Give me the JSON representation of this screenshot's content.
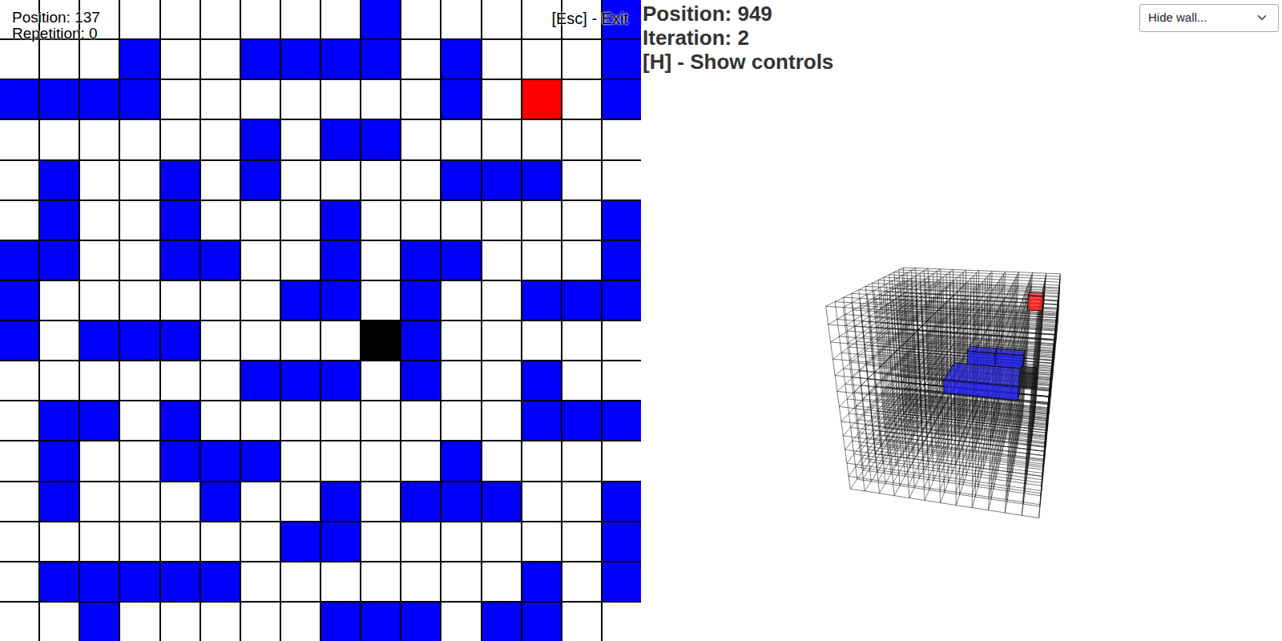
{
  "grid_hud": {
    "position": "Position: 137",
    "repetition": "Repetition: 0",
    "exit": "[Esc] - Exit"
  },
  "grid": {
    "rows": [
      [
        "open",
        "open",
        "open",
        "open",
        "open",
        "open",
        "open",
        "open",
        "open",
        "wall",
        "open",
        "open",
        "open",
        "open",
        "open",
        "wall"
      ],
      [
        "open",
        "open",
        "open",
        "wall",
        "open",
        "open",
        "wall",
        "wall",
        "wall",
        "wall",
        "open",
        "wall",
        "open",
        "open",
        "open",
        "wall"
      ],
      [
        "wall",
        "wall",
        "wall",
        "wall",
        "open",
        "open",
        "open",
        "open",
        "open",
        "open",
        "open",
        "wall",
        "open",
        "goal",
        "open",
        "wall"
      ],
      [
        "open",
        "open",
        "open",
        "open",
        "open",
        "open",
        "wall",
        "open",
        "wall",
        "wall",
        "open",
        "open",
        "open",
        "open",
        "open",
        "open"
      ],
      [
        "open",
        "wall",
        "open",
        "open",
        "wall",
        "open",
        "wall",
        "open",
        "open",
        "open",
        "open",
        "wall",
        "wall",
        "wall",
        "open",
        "open"
      ],
      [
        "open",
        "wall",
        "open",
        "open",
        "wall",
        "open",
        "open",
        "open",
        "wall",
        "open",
        "open",
        "open",
        "open",
        "open",
        "open",
        "wall"
      ],
      [
        "wall",
        "wall",
        "open",
        "open",
        "wall",
        "wall",
        "open",
        "open",
        "wall",
        "open",
        "wall",
        "wall",
        "open",
        "open",
        "open",
        "wall"
      ],
      [
        "wall",
        "open",
        "open",
        "open",
        "open",
        "open",
        "open",
        "wall",
        "wall",
        "open",
        "wall",
        "open",
        "open",
        "wall",
        "wall",
        "wall"
      ],
      [
        "wall",
        "open",
        "wall",
        "wall",
        "wall",
        "open",
        "open",
        "open",
        "open",
        "agent",
        "wall",
        "open",
        "open",
        "open",
        "open",
        "open"
      ],
      [
        "open",
        "open",
        "open",
        "open",
        "open",
        "open",
        "wall",
        "wall",
        "wall",
        "open",
        "wall",
        "open",
        "open",
        "wall",
        "open",
        "open"
      ],
      [
        "open",
        "wall",
        "wall",
        "open",
        "wall",
        "open",
        "open",
        "open",
        "open",
        "open",
        "open",
        "open",
        "open",
        "wall",
        "wall",
        "wall"
      ],
      [
        "open",
        "wall",
        "open",
        "open",
        "wall",
        "wall",
        "wall",
        "open",
        "open",
        "open",
        "open",
        "wall",
        "open",
        "open",
        "open",
        "open"
      ],
      [
        "open",
        "wall",
        "open",
        "open",
        "open",
        "wall",
        "open",
        "open",
        "wall",
        "open",
        "wall",
        "wall",
        "wall",
        "open",
        "open",
        "wall"
      ],
      [
        "open",
        "open",
        "open",
        "open",
        "open",
        "open",
        "open",
        "wall",
        "wall",
        "open",
        "open",
        "open",
        "open",
        "open",
        "open",
        "wall"
      ],
      [
        "open",
        "wall",
        "wall",
        "wall",
        "wall",
        "wall",
        "open",
        "open",
        "open",
        "open",
        "open",
        "open",
        "open",
        "wall",
        "open",
        "wall"
      ],
      [
        "open",
        "open",
        "wall",
        "open",
        "open",
        "open",
        "open",
        "open",
        "wall",
        "wall",
        "wall",
        "open",
        "wall",
        "wall",
        "open",
        "open"
      ]
    ]
  },
  "cube_hud": {
    "position": "Position: 949",
    "iteration": "Iteration: 2",
    "controls": "[H] - Show controls"
  },
  "wall_select": {
    "value": "Hide wall..."
  },
  "cube": {
    "blocks": [
      {
        "kind": "goal"
      },
      {
        "kind": "wall"
      },
      {
        "kind": "wall"
      },
      {
        "kind": "wall"
      },
      {
        "kind": "agent"
      }
    ]
  }
}
